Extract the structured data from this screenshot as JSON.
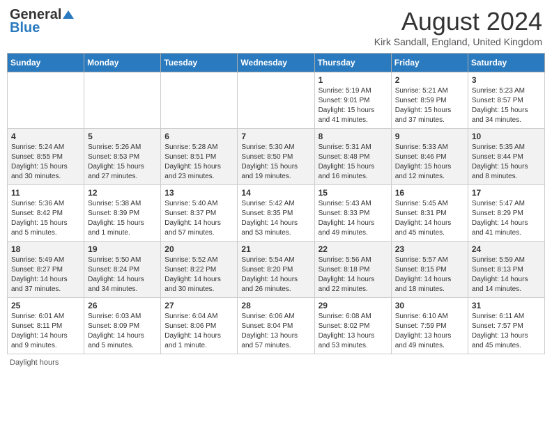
{
  "header": {
    "logo_line1": "General",
    "logo_line2": "Blue",
    "month_title": "August 2024",
    "location": "Kirk Sandall, England, United Kingdom"
  },
  "weekdays": [
    "Sunday",
    "Monday",
    "Tuesday",
    "Wednesday",
    "Thursday",
    "Friday",
    "Saturday"
  ],
  "weeks": [
    [
      {
        "day": "",
        "info": ""
      },
      {
        "day": "",
        "info": ""
      },
      {
        "day": "",
        "info": ""
      },
      {
        "day": "",
        "info": ""
      },
      {
        "day": "1",
        "info": "Sunrise: 5:19 AM\nSunset: 9:01 PM\nDaylight: 15 hours and 41 minutes."
      },
      {
        "day": "2",
        "info": "Sunrise: 5:21 AM\nSunset: 8:59 PM\nDaylight: 15 hours and 37 minutes."
      },
      {
        "day": "3",
        "info": "Sunrise: 5:23 AM\nSunset: 8:57 PM\nDaylight: 15 hours and 34 minutes."
      }
    ],
    [
      {
        "day": "4",
        "info": "Sunrise: 5:24 AM\nSunset: 8:55 PM\nDaylight: 15 hours and 30 minutes."
      },
      {
        "day": "5",
        "info": "Sunrise: 5:26 AM\nSunset: 8:53 PM\nDaylight: 15 hours and 27 minutes."
      },
      {
        "day": "6",
        "info": "Sunrise: 5:28 AM\nSunset: 8:51 PM\nDaylight: 15 hours and 23 minutes."
      },
      {
        "day": "7",
        "info": "Sunrise: 5:30 AM\nSunset: 8:50 PM\nDaylight: 15 hours and 19 minutes."
      },
      {
        "day": "8",
        "info": "Sunrise: 5:31 AM\nSunset: 8:48 PM\nDaylight: 15 hours and 16 minutes."
      },
      {
        "day": "9",
        "info": "Sunrise: 5:33 AM\nSunset: 8:46 PM\nDaylight: 15 hours and 12 minutes."
      },
      {
        "day": "10",
        "info": "Sunrise: 5:35 AM\nSunset: 8:44 PM\nDaylight: 15 hours and 8 minutes."
      }
    ],
    [
      {
        "day": "11",
        "info": "Sunrise: 5:36 AM\nSunset: 8:42 PM\nDaylight: 15 hours and 5 minutes."
      },
      {
        "day": "12",
        "info": "Sunrise: 5:38 AM\nSunset: 8:39 PM\nDaylight: 15 hours and 1 minute."
      },
      {
        "day": "13",
        "info": "Sunrise: 5:40 AM\nSunset: 8:37 PM\nDaylight: 14 hours and 57 minutes."
      },
      {
        "day": "14",
        "info": "Sunrise: 5:42 AM\nSunset: 8:35 PM\nDaylight: 14 hours and 53 minutes."
      },
      {
        "day": "15",
        "info": "Sunrise: 5:43 AM\nSunset: 8:33 PM\nDaylight: 14 hours and 49 minutes."
      },
      {
        "day": "16",
        "info": "Sunrise: 5:45 AM\nSunset: 8:31 PM\nDaylight: 14 hours and 45 minutes."
      },
      {
        "day": "17",
        "info": "Sunrise: 5:47 AM\nSunset: 8:29 PM\nDaylight: 14 hours and 41 minutes."
      }
    ],
    [
      {
        "day": "18",
        "info": "Sunrise: 5:49 AM\nSunset: 8:27 PM\nDaylight: 14 hours and 37 minutes."
      },
      {
        "day": "19",
        "info": "Sunrise: 5:50 AM\nSunset: 8:24 PM\nDaylight: 14 hours and 34 minutes."
      },
      {
        "day": "20",
        "info": "Sunrise: 5:52 AM\nSunset: 8:22 PM\nDaylight: 14 hours and 30 minutes."
      },
      {
        "day": "21",
        "info": "Sunrise: 5:54 AM\nSunset: 8:20 PM\nDaylight: 14 hours and 26 minutes."
      },
      {
        "day": "22",
        "info": "Sunrise: 5:56 AM\nSunset: 8:18 PM\nDaylight: 14 hours and 22 minutes."
      },
      {
        "day": "23",
        "info": "Sunrise: 5:57 AM\nSunset: 8:15 PM\nDaylight: 14 hours and 18 minutes."
      },
      {
        "day": "24",
        "info": "Sunrise: 5:59 AM\nSunset: 8:13 PM\nDaylight: 14 hours and 14 minutes."
      }
    ],
    [
      {
        "day": "25",
        "info": "Sunrise: 6:01 AM\nSunset: 8:11 PM\nDaylight: 14 hours and 9 minutes."
      },
      {
        "day": "26",
        "info": "Sunrise: 6:03 AM\nSunset: 8:09 PM\nDaylight: 14 hours and 5 minutes."
      },
      {
        "day": "27",
        "info": "Sunrise: 6:04 AM\nSunset: 8:06 PM\nDaylight: 14 hours and 1 minute."
      },
      {
        "day": "28",
        "info": "Sunrise: 6:06 AM\nSunset: 8:04 PM\nDaylight: 13 hours and 57 minutes."
      },
      {
        "day": "29",
        "info": "Sunrise: 6:08 AM\nSunset: 8:02 PM\nDaylight: 13 hours and 53 minutes."
      },
      {
        "day": "30",
        "info": "Sunrise: 6:10 AM\nSunset: 7:59 PM\nDaylight: 13 hours and 49 minutes."
      },
      {
        "day": "31",
        "info": "Sunrise: 6:11 AM\nSunset: 7:57 PM\nDaylight: 13 hours and 45 minutes."
      }
    ]
  ],
  "footer": {
    "daylight_hours_label": "Daylight hours"
  }
}
